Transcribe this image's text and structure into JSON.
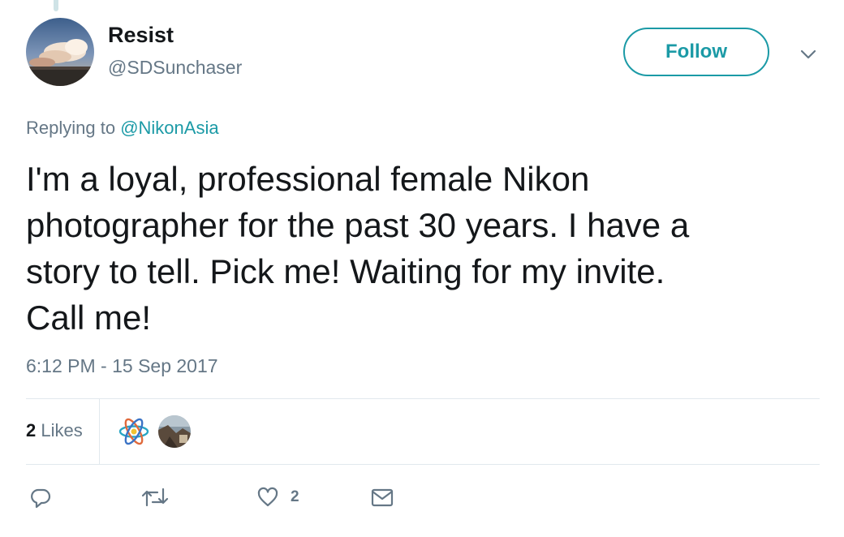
{
  "tweet": {
    "display_name": "Resist",
    "handle": "@SDSunchaser",
    "follow_label": "Follow",
    "replying_prefix": "Replying to",
    "replying_to": "@NikonAsia",
    "lines": [
      "I'm a loyal, professional female Nikon",
      "photographer for the past 30 years. I have a",
      "story to tell. Pick me! Waiting for my invite.",
      "Call me!"
    ],
    "timestamp": "6:12 PM - 15 Sep 2017"
  },
  "stats": {
    "likes_count": "2",
    "likes_label": "Likes"
  },
  "actions": {
    "like_count": "2"
  },
  "icons": [
    "thread-line",
    "avatar",
    "chevron-down-icon",
    "atom-icon",
    "reply-icon",
    "retweet-icon",
    "heart-icon",
    "mail-icon"
  ],
  "colors": {
    "accent": "#1b9aa6",
    "secondary_text": "#657786",
    "divider": "#e1e8ed"
  }
}
